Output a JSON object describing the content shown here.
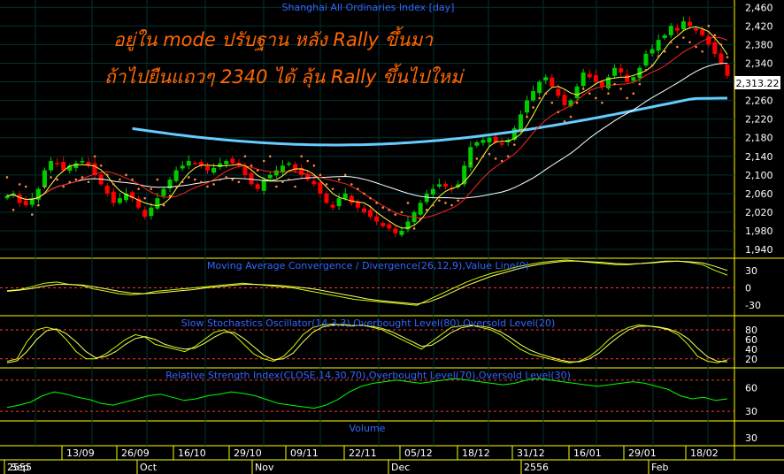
{
  "chart_data": [
    {
      "type": "candlestick",
      "title": "Shanghai All Ordinaries Index [day]",
      "overlay_text": [
        "อยู่ใน mode ปรับฐาน หลัง Rally ขึ้นมา",
        "ถ้าไปยืนแถวๆ 2340 ได้ ลุ้น Rally ขึ้นไปใหม่"
      ],
      "last_price_label": "2,313.22",
      "y_ticks": [
        "2,460",
        "2,420",
        "2,380",
        "2,340",
        "2,300",
        "2,260",
        "2,220",
        "2,180",
        "2,140",
        "2,100",
        "2,060",
        "2,020",
        "1,980",
        "1,940"
      ],
      "ylim": [
        1925,
        2470
      ],
      "close": [
        2055,
        2060,
        2040,
        2035,
        2050,
        2070,
        2110,
        2130,
        2125,
        2110,
        2120,
        2125,
        2130,
        2120,
        2100,
        2080,
        2060,
        2040,
        2050,
        2060,
        2050,
        2030,
        2010,
        2030,
        2050,
        2070,
        2090,
        2110,
        2120,
        2130,
        2125,
        2120,
        2110,
        2115,
        2125,
        2130,
        2125,
        2120,
        2100,
        2080,
        2070,
        2090,
        2100,
        2110,
        2120,
        2125,
        2110,
        2100,
        2090,
        2080,
        2060,
        2040,
        2030,
        2050,
        2060,
        2040,
        2030,
        2020,
        2010,
        2000,
        1990,
        1985,
        1975,
        1980,
        2000,
        2020,
        2040,
        2060,
        2070,
        2080,
        2075,
        2070,
        2080,
        2120,
        2160,
        2170,
        2175,
        2180,
        2170,
        2165,
        2175,
        2200,
        2230,
        2260,
        2280,
        2300,
        2310,
        2290,
        2270,
        2250,
        2260,
        2290,
        2320,
        2310,
        2300,
        2290,
        2310,
        2330,
        2320,
        2300,
        2310,
        2330,
        2360,
        2370,
        2390,
        2400,
        2420,
        2410,
        2430,
        2420,
        2410,
        2400,
        2380,
        2360,
        2340,
        2313
      ],
      "line_labels": [
        "Moving average (white)",
        "Moving average (yellow)",
        "Moving average (red)",
        "Moving average (light blue)",
        "Parabolic SAR (dots)"
      ]
    },
    {
      "type": "line",
      "title": "Moving Average Convergence / Divergence(26,12,9),Value Line(0)",
      "y_ticks": [
        "30",
        "0",
        "-30"
      ],
      "ylim": [
        -45,
        45
      ],
      "series": [
        {
          "name": "",
          "color": "#ccff00",
          "values": [
            -5,
            -3,
            2,
            8,
            10,
            6,
            4,
            -2,
            -6,
            -10,
            -12,
            -10,
            -6,
            -4,
            -2,
            0,
            2,
            4,
            6,
            8,
            6,
            4,
            2,
            0,
            -4,
            -8,
            -12,
            -16,
            -20,
            -22,
            -24,
            -26,
            -28,
            -30,
            -20,
            -10,
            0,
            10,
            18,
            25,
            30,
            36,
            40,
            44,
            46,
            48,
            46,
            44,
            42,
            40,
            40,
            42,
            44,
            46,
            46,
            44,
            40,
            30,
            22
          ]
        },
        {
          "name": "",
          "color": "#ffff66",
          "values": [
            -6,
            -4,
            -1,
            3,
            6,
            6,
            5,
            2,
            -2,
            -6,
            -9,
            -10,
            -9,
            -7,
            -5,
            -3,
            0,
            2,
            4,
            6,
            6,
            5,
            4,
            2,
            0,
            -3,
            -7,
            -11,
            -15,
            -19,
            -22,
            -24,
            -26,
            -28,
            -24,
            -16,
            -6,
            4,
            12,
            20,
            26,
            32,
            37,
            41,
            44,
            46,
            46,
            45,
            44,
            42,
            41,
            42,
            43,
            45,
            46,
            45,
            43,
            37,
            30
          ]
        }
      ]
    },
    {
      "type": "line",
      "title": "Slow Stochastics Oscillator(14,3,3),Overbought Level(80),Oversold Level(20)",
      "y_ticks": [
        "80",
        "60",
        "40",
        "20"
      ],
      "ylim": [
        5,
        100
      ],
      "series": [
        {
          "name": "",
          "color": "#ccff00",
          "values": [
            15,
            20,
            55,
            80,
            85,
            80,
            60,
            35,
            20,
            20,
            30,
            45,
            60,
            70,
            65,
            50,
            45,
            40,
            35,
            45,
            60,
            75,
            80,
            70,
            50,
            30,
            20,
            15,
            25,
            45,
            70,
            85,
            90,
            92,
            90,
            88,
            90,
            85,
            80,
            70,
            60,
            50,
            40,
            55,
            70,
            85,
            88,
            90,
            85,
            80,
            70,
            55,
            40,
            30,
            25,
            20,
            15,
            12,
            15,
            25,
            40,
            60,
            75,
            85,
            90,
            88,
            85,
            80,
            70,
            50,
            25,
            15,
            12,
            18
          ]
        },
        {
          "name": "",
          "color": "#ffff66",
          "values": [
            12,
            16,
            35,
            60,
            78,
            82,
            72,
            55,
            35,
            22,
            25,
            35,
            50,
            62,
            66,
            60,
            50,
            44,
            40,
            42,
            52,
            65,
            75,
            75,
            62,
            45,
            28,
            18,
            20,
            32,
            55,
            75,
            86,
            90,
            91,
            89,
            89,
            87,
            83,
            76,
            66,
            56,
            46,
            48,
            60,
            74,
            84,
            88,
            88,
            84,
            76,
            64,
            50,
            38,
            30,
            24,
            18,
            14,
            14,
            20,
            32,
            50,
            66,
            80,
            87,
            88,
            86,
            82,
            75,
            62,
            42,
            24,
            15,
            14
          ]
        }
      ]
    },
    {
      "type": "line",
      "title": "Relative Strength Index(CLOSE,14,30,70),Overbought Level(70),Oversold Level(30)",
      "y_ticks": [
        "60",
        "30"
      ],
      "ylim": [
        20,
        80
      ],
      "series": [
        {
          "name": "",
          "color": "#00ff00",
          "values": [
            35,
            38,
            42,
            50,
            55,
            52,
            48,
            45,
            40,
            38,
            42,
            46,
            50,
            52,
            48,
            44,
            46,
            50,
            52,
            55,
            53,
            50,
            45,
            40,
            38,
            36,
            34,
            38,
            45,
            55,
            62,
            66,
            68,
            70,
            68,
            66,
            68,
            70,
            72,
            70,
            68,
            66,
            64,
            66,
            70,
            72,
            70,
            68,
            66,
            64,
            62,
            64,
            66,
            68,
            66,
            62,
            58,
            50,
            46,
            48,
            44,
            46
          ]
        }
      ]
    },
    {
      "type": "bar",
      "title": "Volume",
      "y_ticks": [
        "30"
      ],
      "ylim": [
        0,
        60
      ],
      "values": []
    }
  ],
  "x_axis": {
    "upper_labels": [
      "13/09",
      "26/09",
      "16/10",
      "29/10",
      "09/11",
      "22/11",
      "05/12",
      "18/12",
      "31/12",
      "16/01",
      "29/01",
      "18/02"
    ],
    "lower_labels": [
      "2555",
      "Sep",
      "Oct",
      "Nov",
      "Dec",
      "2556",
      "Feb"
    ]
  },
  "colors": {
    "background": "#000000",
    "panel_border": "#ffff00",
    "grid": "#003333",
    "title": "#3366ff",
    "overlay_text": "#ff6600",
    "candle_up": "#00cc00",
    "candle_down": "#ff0000",
    "ma_white": "#ffffff",
    "ma_yellow": "#ffff44",
    "ma_red": "#ff2222",
    "ma_blue": "#66ccff",
    "sar": "#ff8844",
    "ref_line": "#ff3333",
    "axis_text": "#ffffff"
  }
}
